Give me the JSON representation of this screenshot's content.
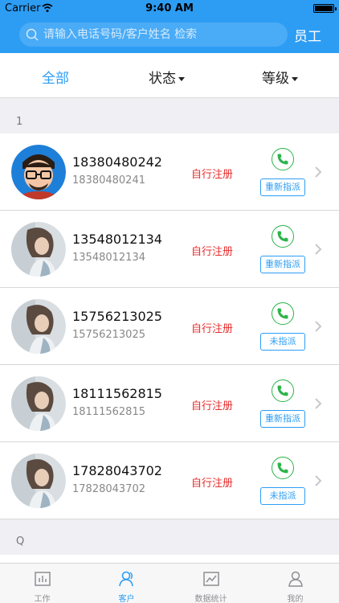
{
  "status_bar": {
    "carrier": "Carrier",
    "time": "9:40 AM"
  },
  "header": {
    "search_placeholder": "请输入电话号码/客户姓名 检索",
    "staff_label": "员工"
  },
  "filters": [
    {
      "label": "全部",
      "active": true
    },
    {
      "label": "状态",
      "active": false
    },
    {
      "label": "等级",
      "active": false
    }
  ],
  "sections": [
    {
      "index": "1"
    },
    {
      "index": "Q"
    }
  ],
  "customers": [
    {
      "phone": "18380480242",
      "sub_phone": "18380480241",
      "source": "自行注册",
      "assign": "重新指派",
      "avatar": "cartoon"
    },
    {
      "phone": "13548012134",
      "sub_phone": "13548012134",
      "source": "自行注册",
      "assign": "重新指派",
      "avatar": "photo"
    },
    {
      "phone": "15756213025",
      "sub_phone": "15756213025",
      "source": "自行注册",
      "assign": "未指派",
      "avatar": "photo"
    },
    {
      "phone": "18111562815",
      "sub_phone": "18111562815",
      "source": "自行注册",
      "assign": "重新指派",
      "avatar": "photo"
    },
    {
      "phone": "17828043702",
      "sub_phone": "17828043702",
      "source": "自行注册",
      "assign": "未指派",
      "avatar": "photo"
    }
  ],
  "tabs": [
    {
      "label": "工作",
      "icon": "chart-icon",
      "active": false
    },
    {
      "label": "客户",
      "icon": "customers-icon",
      "active": true
    },
    {
      "label": "数据统计",
      "icon": "trend-icon",
      "active": false
    },
    {
      "label": "我的",
      "icon": "profile-icon",
      "active": false
    }
  ],
  "colors": {
    "primary": "#2d9df4",
    "call_green": "#2cb44a",
    "source_red": "#e62e2e"
  }
}
